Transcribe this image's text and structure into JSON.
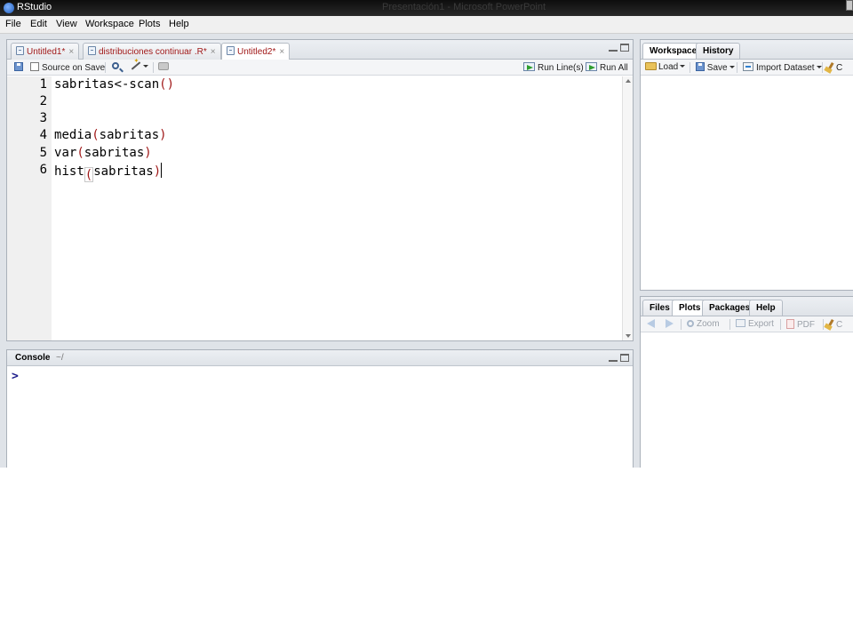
{
  "titlebar": {
    "app_title": "RStudio",
    "ghost_title": "Presentación1 - Microsoft PowerPoint"
  },
  "menu": [
    "File",
    "Edit",
    "View",
    "Workspace",
    "Plots",
    "Help"
  ],
  "editor": {
    "tabs": [
      {
        "label": "Untitled1*",
        "modified": true
      },
      {
        "label": "distribuciones continuar .R*",
        "modified": true
      },
      {
        "label": "Untitled2*",
        "modified": true,
        "active": true
      }
    ],
    "toolbar": {
      "source_on_save": "Source on Save",
      "run_line": "Run Line(s)",
      "run_all": "Run All"
    },
    "lines": [
      {
        "num": "1",
        "code": "sabritas<-scan()"
      },
      {
        "num": "2",
        "code": ""
      },
      {
        "num": "3",
        "code": ""
      },
      {
        "num": "4",
        "code": "media(sabritas)"
      },
      {
        "num": "5",
        "code": "var(sabritas)"
      },
      {
        "num": "6",
        "code": "hist(sabritas)"
      }
    ]
  },
  "console": {
    "title": "Console",
    "path": "~/",
    "prompt": ">"
  },
  "workspace_pane": {
    "tabs": [
      "Workspace",
      "History"
    ],
    "toolbar": {
      "load": "Load",
      "save": "Save",
      "import": "Import Dataset",
      "clear": "C"
    }
  },
  "files_pane": {
    "tabs": [
      "Files",
      "Plots",
      "Packages",
      "Help"
    ],
    "toolbar": {
      "zoom": "Zoom",
      "export": "Export",
      "pdf": "PDF",
      "clear": "C"
    }
  },
  "colors": {
    "modified_tab_text": "#a01818",
    "paren": "#a01818",
    "prompt": "#1a1a8a",
    "titlebar": "#1a1a1a"
  }
}
